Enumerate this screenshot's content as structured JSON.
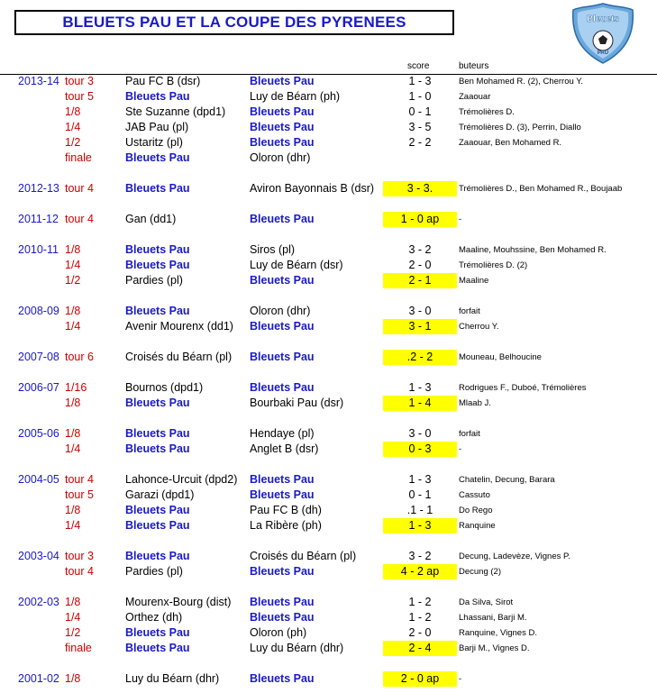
{
  "title": "BLEUETS PAU ET LA COUPE DES PYRENEES",
  "logo": {
    "text": "Bleuets PAU",
    "icon": "football-shield-logo"
  },
  "headers": {
    "score": "score",
    "scorers": "buteurs"
  },
  "rows": [
    {
      "season": "2013-14",
      "round": "tour 3",
      "home": "Pau FC B (dsr)",
      "away": "Bleuets Pau",
      "score": "1 - 3",
      "hl": false,
      "scorers": "Ben Mohamed R. (2), Cherrou Y.",
      "bleu": "away"
    },
    {
      "season": "",
      "round": "tour 5",
      "home": "Bleuets Pau",
      "away": "Luy de Béarn (ph)",
      "score": "1 - 0",
      "hl": false,
      "scorers": "Zaaouar",
      "bleu": "home"
    },
    {
      "season": "",
      "round": "1/8",
      "home": "Ste Suzanne (dpd1)",
      "away": "Bleuets Pau",
      "score": "0 - 1",
      "hl": false,
      "scorers": "Trémolières D.",
      "bleu": "away"
    },
    {
      "season": "",
      "round": "1/4",
      "home": "JAB Pau (pl)",
      "away": "Bleuets Pau",
      "score": "3 - 5",
      "hl": false,
      "scorers": "Trémolières D. (3), Perrin, Diallo",
      "bleu": "away"
    },
    {
      "season": "",
      "round": "1/2",
      "home": "Ustaritz (pl)",
      "away": "Bleuets Pau",
      "score": "2 - 2",
      "hl": false,
      "scorers": "Zaaouar, Ben Mohamed R.",
      "bleu": "away"
    },
    {
      "season": "",
      "round": "finale",
      "home": "Bleuets Pau",
      "away": "Oloron (dhr)",
      "score": "",
      "hl": false,
      "scorers": "",
      "bleu": "home"
    },
    {
      "season": "2012-13",
      "round": "tour 4",
      "home": "Bleuets Pau",
      "away": "Aviron Bayonnais B (dsr)",
      "score": "3 - 3.",
      "hl": true,
      "scorers": "Trémolières D., Ben Mohamed R., Boujaab",
      "bleu": "home"
    },
    {
      "season": "2011-12",
      "round": "tour 4",
      "home": "Gan (dd1)",
      "away": "Bleuets Pau",
      "score": "1 - 0 ap",
      "hl": true,
      "scorers": "-",
      "bleu": "away"
    },
    {
      "season": "2010-11",
      "round": "1/8",
      "home": "Bleuets Pau",
      "away": "Siros (pl)",
      "score": "3 - 2",
      "hl": false,
      "scorers": "Maaline, Mouhssine, Ben Mohamed R.",
      "bleu": "home"
    },
    {
      "season": "",
      "round": "1/4",
      "home": "Bleuets Pau",
      "away": "Luy de Béarn (dsr)",
      "score": "2 - 0",
      "hl": false,
      "scorers": "Trémolières D. (2)",
      "bleu": "home"
    },
    {
      "season": "",
      "round": "1/2",
      "home": "Pardies (pl)",
      "away": "Bleuets Pau",
      "score": "2 - 1",
      "hl": true,
      "scorers": "Maaline",
      "bleu": "away"
    },
    {
      "season": "2008-09",
      "round": "1/8",
      "home": "Bleuets Pau",
      "away": "Oloron (dhr)",
      "score": "3 - 0",
      "hl": false,
      "scorers": "forfait",
      "bleu": "home"
    },
    {
      "season": "",
      "round": "1/4",
      "home": "Avenir Mourenx (dd1)",
      "away": "Bleuets Pau",
      "score": "3 - 1",
      "hl": true,
      "scorers": "Cherrou Y.",
      "bleu": "away"
    },
    {
      "season": "2007-08",
      "round": "tour 6",
      "home": "Croisés du Béarn (pl)",
      "away": "Bleuets Pau",
      "score": ".2 - 2",
      "hl": true,
      "scorers": "Mouneau, Belhoucine",
      "bleu": "away"
    },
    {
      "season": "2006-07",
      "round": "1/16",
      "home": "Bournos (dpd1)",
      "away": "Bleuets Pau",
      "score": "1 - 3",
      "hl": false,
      "scorers": "Rodrigues F., Duboé, Trémolières",
      "bleu": "away"
    },
    {
      "season": "",
      "round": "1/8",
      "home": "Bleuets Pau",
      "away": "Bourbaki Pau (dsr)",
      "score": "1 - 4",
      "hl": true,
      "scorers": "Mlaab J.",
      "bleu": "home"
    },
    {
      "season": "2005-06",
      "round": "1/8",
      "home": "Bleuets Pau",
      "away": "Hendaye (pl)",
      "score": "3 - 0",
      "hl": false,
      "scorers": "forfait",
      "bleu": "home"
    },
    {
      "season": "",
      "round": "1/4",
      "home": "Bleuets Pau",
      "away": "Anglet B (dsr)",
      "score": "0 - 3",
      "hl": true,
      "scorers": "-",
      "bleu": "home"
    },
    {
      "season": "2004-05",
      "round": "tour 4",
      "home": "Lahonce-Urcuit (dpd2)",
      "away": "Bleuets Pau",
      "score": "1 - 3",
      "hl": false,
      "scorers": "Chatelin, Decung, Barara",
      "bleu": "away"
    },
    {
      "season": "",
      "round": "tour 5",
      "home": "Garazi (dpd1)",
      "away": "Bleuets Pau",
      "score": "0 - 1",
      "hl": false,
      "scorers": "Cassuto",
      "bleu": "away"
    },
    {
      "season": "",
      "round": "1/8",
      "home": "Bleuets Pau",
      "away": "Pau FC B (dh)",
      "score": ".1 - 1",
      "hl": false,
      "scorers": "Do Rego",
      "bleu": "home"
    },
    {
      "season": "",
      "round": "1/4",
      "home": "Bleuets Pau",
      "away": "La Ribère (ph)",
      "score": "1 - 3",
      "hl": true,
      "scorers": "Ranquine",
      "bleu": "home"
    },
    {
      "season": "2003-04",
      "round": "tour 3",
      "home": "Bleuets Pau",
      "away": "Croisés du Béarn (pl)",
      "score": "3 - 2",
      "hl": false,
      "scorers": "Decung, Ladevèze, Vignes P.",
      "bleu": "home"
    },
    {
      "season": "",
      "round": "tour 4",
      "home": "Pardies (pl)",
      "away": "Bleuets Pau",
      "score": "4 - 2 ap",
      "hl": true,
      "scorers": "Decung (2)",
      "bleu": "away"
    },
    {
      "season": "2002-03",
      "round": "1/8",
      "home": "Mourenx-Bourg (dist)",
      "away": "Bleuets Pau",
      "score": "1 - 2",
      "hl": false,
      "scorers": "Da Silva, Sirot",
      "bleu": "away"
    },
    {
      "season": "",
      "round": "1/4",
      "home": "Orthez (dh)",
      "away": "Bleuets Pau",
      "score": "1 - 2",
      "hl": false,
      "scorers": "Lhassani, Barji M.",
      "bleu": "away"
    },
    {
      "season": "",
      "round": "1/2",
      "home": "Bleuets Pau",
      "away": "Oloron (ph)",
      "score": "2 - 0",
      "hl": false,
      "scorers": "Ranquine, Vignes D.",
      "bleu": "home"
    },
    {
      "season": "",
      "round": "finale",
      "home": "Bleuets Pau",
      "away": "Luy du Béarn (dhr)",
      "score": "2 - 4",
      "hl": true,
      "scorers": "Barji M., Vignes D.",
      "bleu": "home"
    },
    {
      "season": "2001-02",
      "round": "1/8",
      "home": "Luy du Béarn (dhr)",
      "away": "Bleuets Pau",
      "score": "2 - 0 ap",
      "hl": true,
      "scorers": "-",
      "bleu": "away"
    }
  ]
}
